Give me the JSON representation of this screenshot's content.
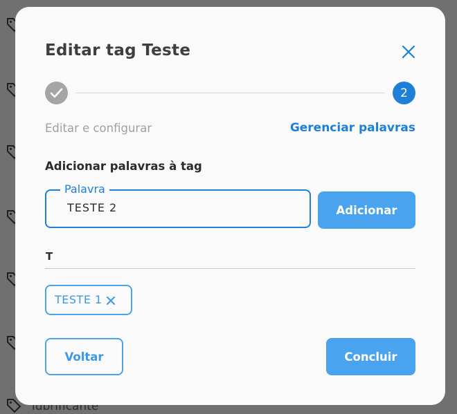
{
  "background": {
    "partial_item_text": "lubrificante"
  },
  "modal": {
    "title": "Editar tag Teste",
    "stepper": {
      "step1_label": "Editar e configurar",
      "step2_number": "2",
      "step2_label": "Gerenciar palavras"
    },
    "section_title": "Adicionar palavras à tag",
    "word_field": {
      "legend": "Palavra",
      "value": "TESTE 2"
    },
    "add_button_label": "Adicionar",
    "group_letter": "T",
    "chips": [
      {
        "label": "TESTE 1"
      }
    ],
    "back_button_label": "Voltar",
    "finish_button_label": "Concluir"
  },
  "colors": {
    "primary": "#1d7fd8",
    "primary_light": "#4aa3ee",
    "completed_step": "#a5a5a5",
    "overlay": "#707070"
  },
  "icons": [
    "tag-icon",
    "close-icon",
    "check-icon",
    "remove-chip-icon"
  ]
}
